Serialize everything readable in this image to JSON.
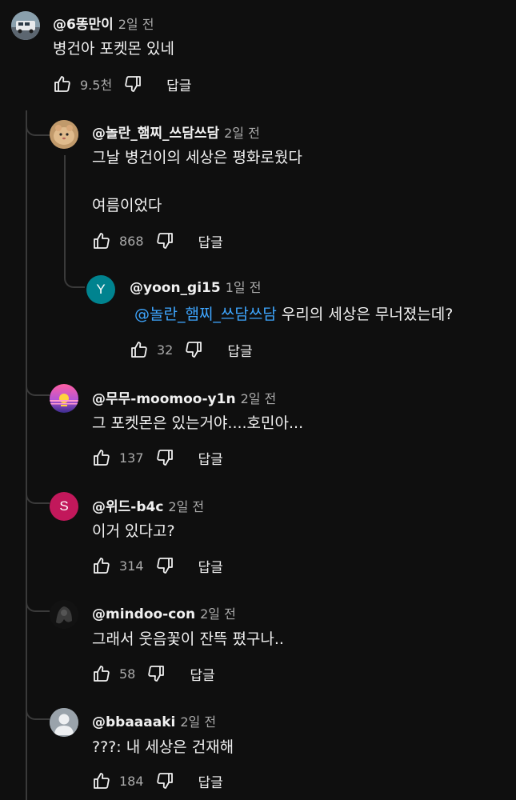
{
  "comments": [
    {
      "author": "@6똥만이",
      "time": "2일 전",
      "text": "병건아 포켓몬 있네",
      "likes": "9.5천",
      "reply_label": "답글",
      "avatar_icon": "van-photo-avatar"
    },
    {
      "author": "@놀란_햄찌_쓰담쓰담",
      "time": "2일 전",
      "text_line1": "그날 병건이의 세상은 평화로웠다",
      "text_line2": "여름이었다",
      "likes": "868",
      "reply_label": "답글",
      "avatar_icon": "hamster-photo-avatar"
    },
    {
      "author": "@yoon_gi15",
      "time": "1일 전",
      "mention": "@놀란_햄찌_쓰담쓰담",
      "text": " 우리의 세상은 무너졌는데?",
      "likes": "32",
      "reply_label": "답글",
      "avatar_letter": "Y",
      "avatar_color": "#00838f"
    },
    {
      "author": "@무무-moomoo-y1n",
      "time": "2일 전",
      "text": "그 포켓몬은 있는거야....호민아...",
      "likes": "137",
      "reply_label": "답글",
      "avatar_icon": "sunset-photo-avatar"
    },
    {
      "author": "@위드-b4c",
      "time": "2일 전",
      "text": "이거 있다고?",
      "likes": "314",
      "reply_label": "답글",
      "avatar_letter": "S",
      "avatar_color": "#c2185b"
    },
    {
      "author": "@mindoo-con",
      "time": "2일 전",
      "text": "그래서 웃음꽃이 잔뜩 폈구나..",
      "likes": "58",
      "reply_label": "답글",
      "avatar_icon": "dark-photo-avatar"
    },
    {
      "author": "@bbaaaaki",
      "time": "2일 전",
      "text": "???: 내 세상은 건재해",
      "likes": "184",
      "reply_label": "답글",
      "avatar_icon": "default-person-avatar"
    }
  ]
}
